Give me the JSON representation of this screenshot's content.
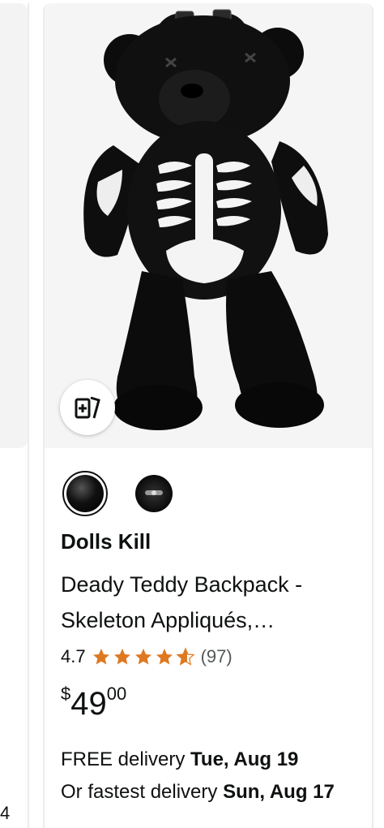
{
  "prev_card": {
    "partial_text": "4"
  },
  "product": {
    "brand": "Dolls Kill",
    "title": "Deady Teddy Backpack - Skeleton Appliqués,…",
    "rating_value": "4.7",
    "rating_stars": 4.7,
    "review_count": "(97)",
    "price_symbol": "$",
    "price_whole": "49",
    "price_fraction": "00",
    "delivery_line1_prefix": "FREE delivery ",
    "delivery_line1_date": "Tue, Aug 19",
    "delivery_line2_prefix": "Or fastest delivery ",
    "delivery_line2_date": "Sun, Aug 17",
    "swatches": [
      "black-selected",
      "black-alt"
    ],
    "image_icon": "teddy-bear-skeleton-backpack-image",
    "compare_icon": "add-to-compare-icon"
  },
  "colors": {
    "star": "#de7921",
    "text": "#0f1111",
    "muted": "#565959",
    "image_bg": "#f5f5f5"
  }
}
